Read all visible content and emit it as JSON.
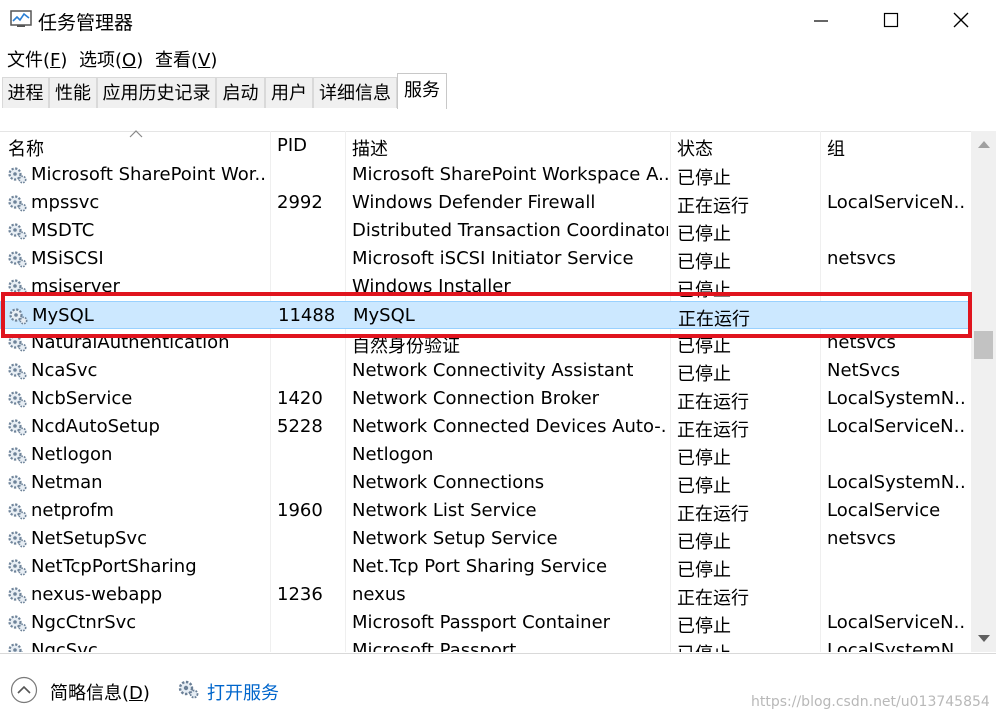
{
  "window": {
    "title": "任务管理器",
    "controls": [
      "minimize",
      "maximize",
      "close"
    ]
  },
  "menu": [
    {
      "label": "文件(",
      "key": "F",
      "end": ")"
    },
    {
      "label": "选项(",
      "key": "O",
      "end": ")"
    },
    {
      "label": "查看(",
      "key": "V",
      "end": ")"
    }
  ],
  "tabs": [
    {
      "label": "进程",
      "active": false
    },
    {
      "label": "性能",
      "active": false
    },
    {
      "label": "应用历史记录",
      "active": false
    },
    {
      "label": "启动",
      "active": false
    },
    {
      "label": "用户",
      "active": false
    },
    {
      "label": "详细信息",
      "active": false
    },
    {
      "label": "服务",
      "active": true
    }
  ],
  "columns": {
    "name": "名称",
    "pid": "PID",
    "desc": "描述",
    "status": "状态",
    "group": "组"
  },
  "services": [
    {
      "name": "Microsoft SharePoint Wor...",
      "pid": "",
      "desc": "Microsoft SharePoint Workspace A...",
      "status": "已停止",
      "group": ""
    },
    {
      "name": "mpssvc",
      "pid": "2992",
      "desc": "Windows Defender Firewall",
      "status": "正在运行",
      "group": "LocalServiceN..."
    },
    {
      "name": "MSDTC",
      "pid": "",
      "desc": "Distributed Transaction Coordinator",
      "status": "已停止",
      "group": ""
    },
    {
      "name": "MSiSCSI",
      "pid": "",
      "desc": "Microsoft iSCSI Initiator Service",
      "status": "已停止",
      "group": "netsvcs"
    },
    {
      "name": "msiserver",
      "pid": "",
      "desc": "Windows Installer",
      "status": "已停止",
      "group": ""
    },
    {
      "name": "MySQL",
      "pid": "11488",
      "desc": "MySQL",
      "status": "正在运行",
      "group": "",
      "selected": true
    },
    {
      "name": "NaturalAuthentication",
      "pid": "",
      "desc": "自然身份验证",
      "status": "已停止",
      "group": "netsvcs"
    },
    {
      "name": "NcaSvc",
      "pid": "",
      "desc": "Network Connectivity Assistant",
      "status": "已停止",
      "group": "NetSvcs"
    },
    {
      "name": "NcbService",
      "pid": "1420",
      "desc": "Network Connection Broker",
      "status": "正在运行",
      "group": "LocalSystemN..."
    },
    {
      "name": "NcdAutoSetup",
      "pid": "5228",
      "desc": "Network Connected Devices Auto-...",
      "status": "正在运行",
      "group": "LocalServiceN..."
    },
    {
      "name": "Netlogon",
      "pid": "",
      "desc": "Netlogon",
      "status": "已停止",
      "group": ""
    },
    {
      "name": "Netman",
      "pid": "",
      "desc": "Network Connections",
      "status": "已停止",
      "group": "LocalSystemN..."
    },
    {
      "name": "netprofm",
      "pid": "1960",
      "desc": "Network List Service",
      "status": "正在运行",
      "group": "LocalService"
    },
    {
      "name": "NetSetupSvc",
      "pid": "",
      "desc": "Network Setup Service",
      "status": "已停止",
      "group": "netsvcs"
    },
    {
      "name": "NetTcpPortSharing",
      "pid": "",
      "desc": "Net.Tcp Port Sharing Service",
      "status": "已停止",
      "group": ""
    },
    {
      "name": "nexus-webapp",
      "pid": "1236",
      "desc": "nexus",
      "status": "正在运行",
      "group": ""
    },
    {
      "name": "NgcCtnrSvc",
      "pid": "",
      "desc": "Microsoft Passport Container",
      "status": "已停止",
      "group": "LocalServiceN..."
    },
    {
      "name": "NgcSvc",
      "pid": "",
      "desc": "Microsoft Passport",
      "status": "已停止",
      "group": "LocalSystemN..."
    }
  ],
  "footer": {
    "brief_label": "简略信息(",
    "brief_key": "D",
    "brief_end": ")",
    "open_services": "打开服务"
  },
  "watermark": "https://blog.csdn.net/u013745854",
  "colors": {
    "selection": "#cce8ff",
    "annotation": "#e0141e",
    "link": "#0066cc"
  }
}
